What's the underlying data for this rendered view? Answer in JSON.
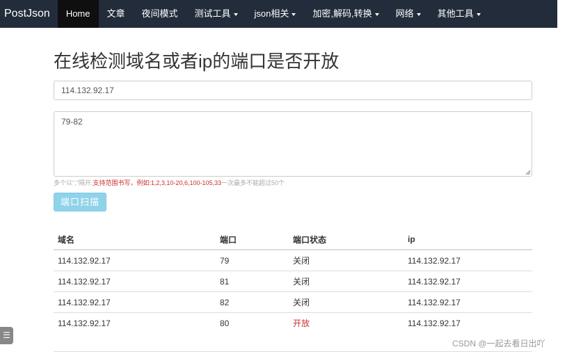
{
  "navbar": {
    "brand": "PostJson",
    "items": [
      {
        "label": "Home"
      },
      {
        "label": "文章"
      },
      {
        "label": "夜间模式"
      },
      {
        "label": "测试工具"
      },
      {
        "label": "json相关"
      },
      {
        "label": "加密,解码,转换"
      },
      {
        "label": "网络"
      },
      {
        "label": "其他工具"
      }
    ]
  },
  "page": {
    "title": "在线检测域名或者ip的端口是否开放"
  },
  "form": {
    "host_value": "114.132.92.17",
    "ports_value": "79-82",
    "hint_prefix": "多个以\",\"隔开,",
    "hint_red": "支持范围书写，例如:1,2,3,10-20,6,100-105,33",
    "hint_suffix": "一次最多不能超过50个",
    "scan_label": "端口扫描"
  },
  "table": {
    "headers": [
      "域名",
      "端口",
      "端口状态",
      "ip"
    ],
    "rows": [
      {
        "domain": "114.132.92.17",
        "port": "79",
        "status": "关闭",
        "ip": "114.132.92.17"
      },
      {
        "domain": "114.132.92.17",
        "port": "81",
        "status": "关闭",
        "ip": "114.132.92.17"
      },
      {
        "domain": "114.132.92.17",
        "port": "82",
        "status": "关闭",
        "ip": "114.132.92.17"
      },
      {
        "domain": "114.132.92.17",
        "port": "80",
        "status": "开放",
        "ip": "114.132.92.17"
      }
    ]
  },
  "side_button": {
    "icon": "menu-icon",
    "glyph": "☰"
  },
  "watermark": "CSDN @一起去看日出吖",
  "colors": {
    "navbar": "#222c3a",
    "active_nav": "#0f0f0f",
    "open_status": "#c9302c",
    "scan_button": "#8fd3ea"
  }
}
